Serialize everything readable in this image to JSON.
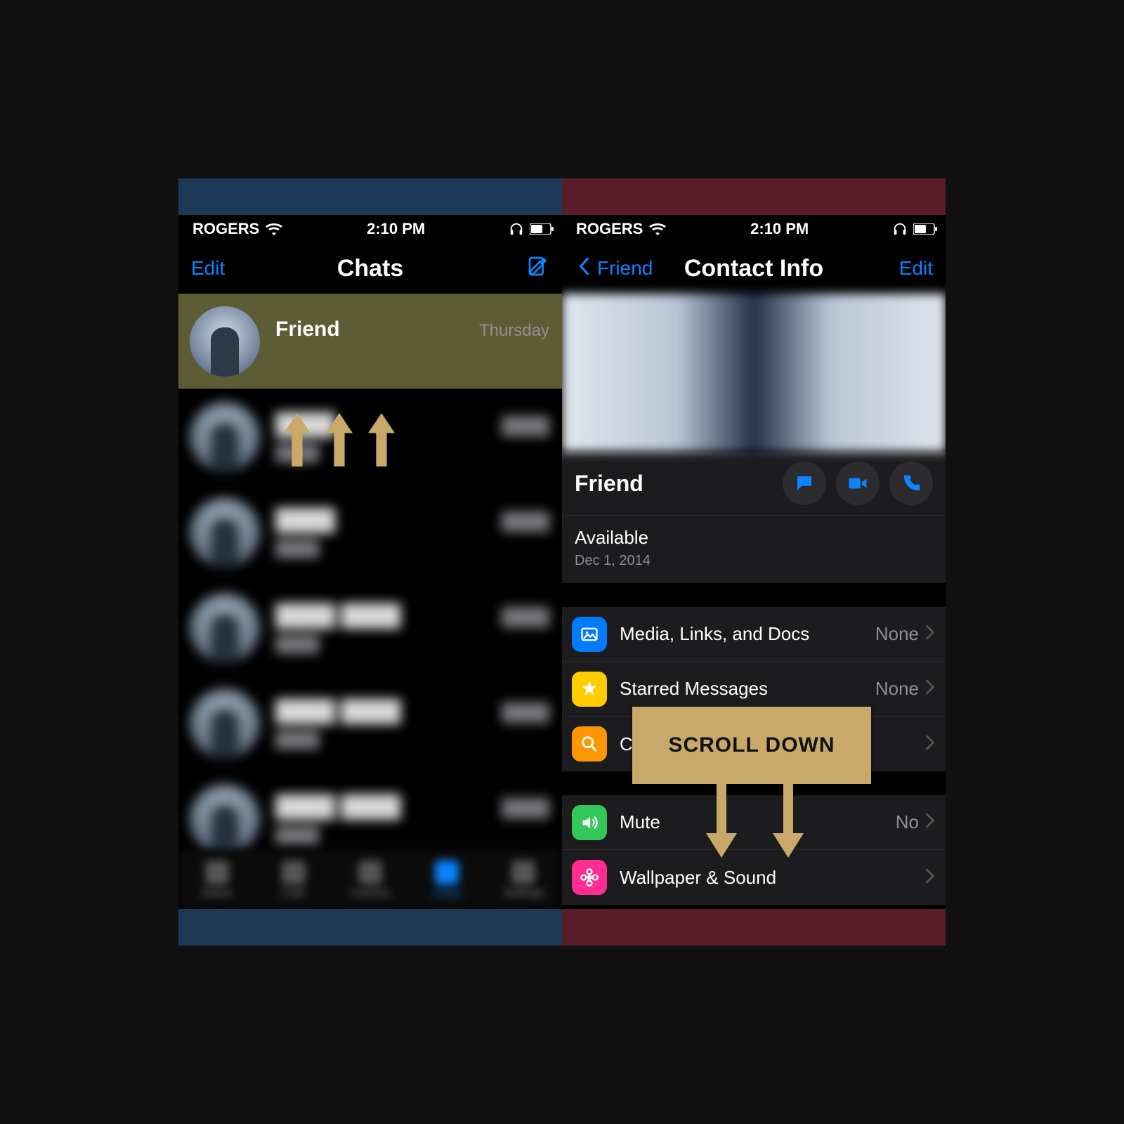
{
  "status_bar": {
    "carrier": "ROGERS",
    "time": "2:10 PM"
  },
  "left_screen": {
    "nav": {
      "left_label": "Edit",
      "title": "Chats"
    },
    "highlighted_chat": {
      "name": "Friend",
      "date": "Thursday"
    },
    "tabs": [
      "Status",
      "Calls",
      "Camera",
      "Chats",
      "Settings"
    ],
    "active_tab_index": 3
  },
  "right_screen": {
    "nav": {
      "back_label": "Friend",
      "title": "Contact Info",
      "right_label": "Edit"
    },
    "contact": {
      "name": "Friend",
      "status": "Available",
      "status_date": "Dec 1, 2014"
    },
    "group1": [
      {
        "icon": "photo",
        "color": "blue",
        "label": "Media, Links, and Docs",
        "value": "None"
      },
      {
        "icon": "star",
        "color": "yellow",
        "label": "Starred Messages",
        "value": "None"
      },
      {
        "icon": "search",
        "color": "orange",
        "label": "Chat Search",
        "value": ""
      }
    ],
    "group2": [
      {
        "icon": "speaker",
        "color": "green",
        "label": "Mute",
        "value": "No"
      },
      {
        "icon": "flower",
        "color": "pink",
        "label": "Wallpaper & Sound",
        "value": ""
      }
    ]
  },
  "annotation": {
    "scroll_label": "SCROLL DOWN"
  }
}
